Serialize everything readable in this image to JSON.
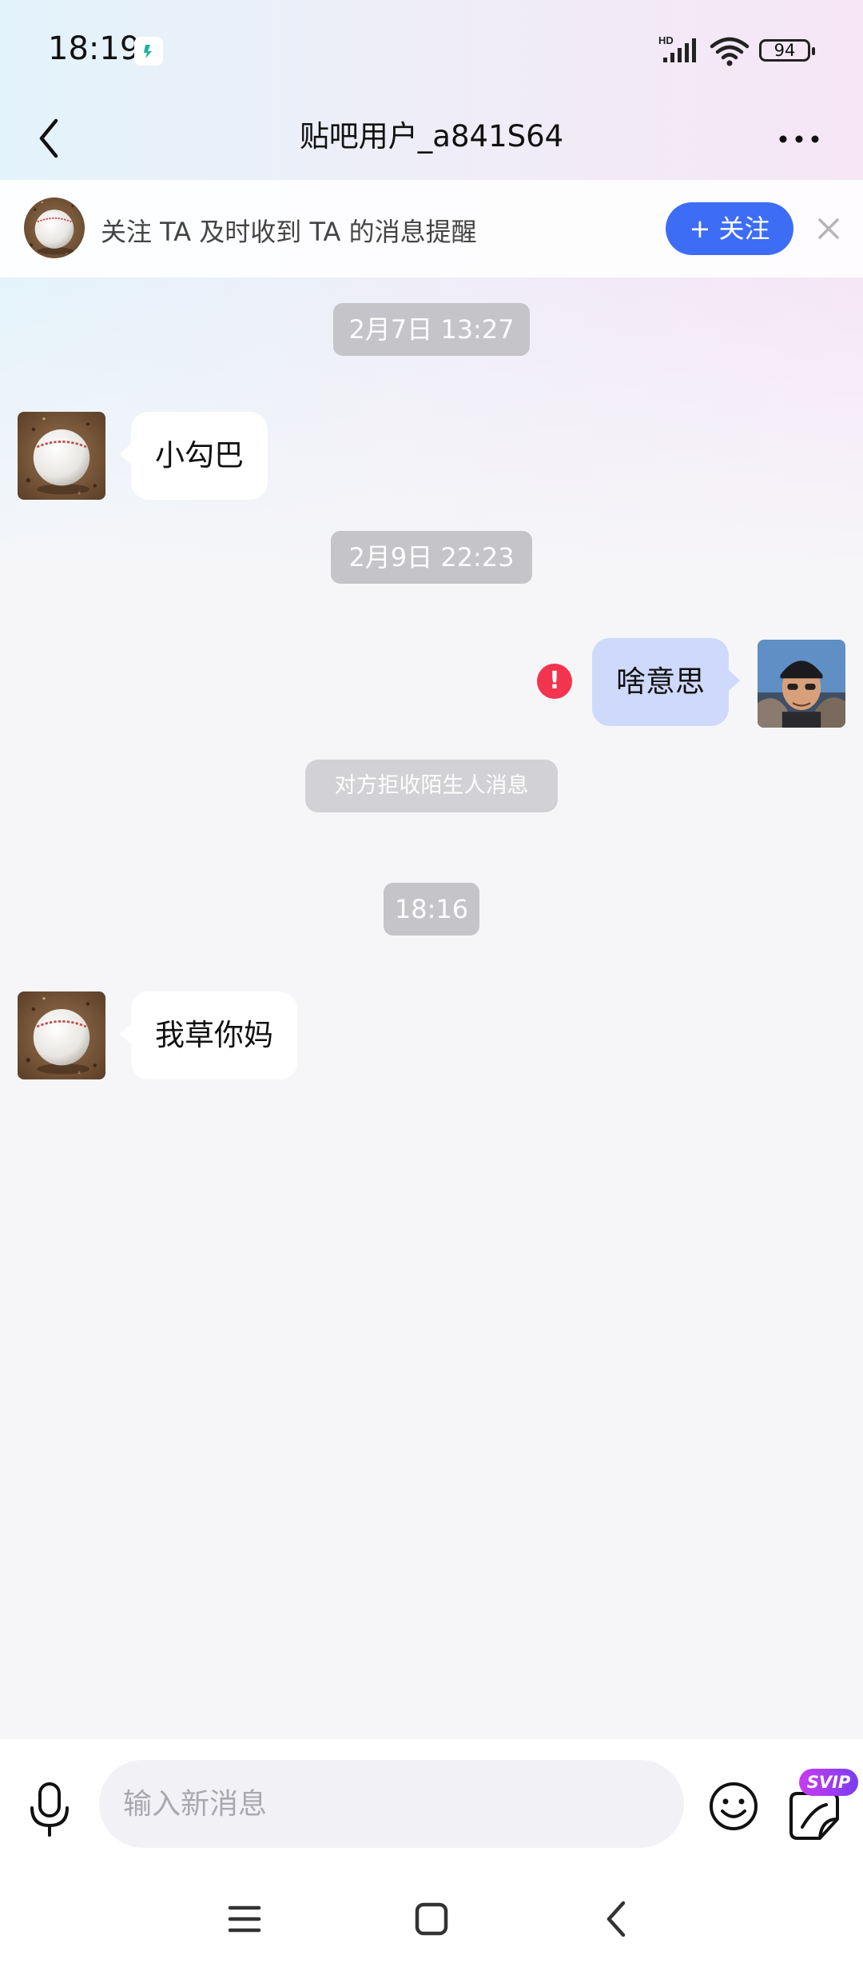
{
  "status_bar": {
    "time": "18:19",
    "network": "HD",
    "battery": "94"
  },
  "header": {
    "title": "贴吧用户_a841S64"
  },
  "follow_bar": {
    "text": "关注 TA 及时收到 TA 的消息提醒",
    "button": "+ 关注"
  },
  "messages": [
    {
      "type": "timestamp",
      "text": "2月7日 13:27"
    },
    {
      "type": "incoming",
      "text": "小勾巴"
    },
    {
      "type": "timestamp",
      "text": "2月9日 22:23"
    },
    {
      "type": "outgoing",
      "text": "啥意思",
      "failed": true
    },
    {
      "type": "notice",
      "text": "对方拒收陌生人消息"
    },
    {
      "type": "timestamp",
      "text": "18:16"
    },
    {
      "type": "incoming",
      "text": "我草你妈"
    }
  ],
  "input_bar": {
    "placeholder": "输入新消息",
    "svip_badge": "SVIP"
  },
  "colors": {
    "accent": "#3d6df5",
    "outgoing_bubble": "#cfd9fb",
    "error": "#f3344e"
  },
  "icons": [
    "back-icon",
    "more-icon",
    "close-icon",
    "error-icon",
    "mic-icon",
    "emoji-icon",
    "sticker-icon",
    "menu-icon",
    "home-icon",
    "nav-back-icon"
  ]
}
